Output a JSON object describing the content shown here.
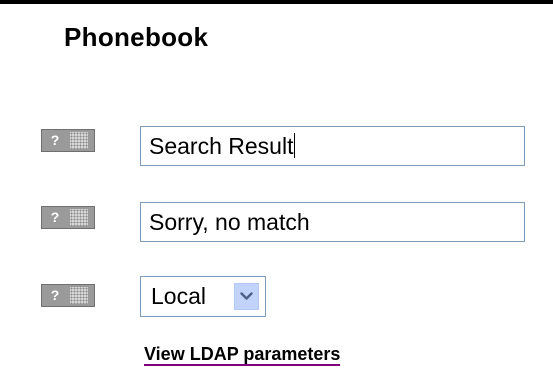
{
  "page": {
    "title": "Phonebook"
  },
  "rows": [
    {
      "help_icon": "question-mark-icon",
      "help_label": "?",
      "value": "Search Result"
    },
    {
      "help_icon": "question-mark-icon",
      "help_label": "?",
      "value": "Sorry, no match"
    },
    {
      "help_icon": "question-mark-icon",
      "help_label": "?",
      "select_value": "Local"
    }
  ],
  "link": {
    "label": "View LDAP parameters"
  },
  "colors": {
    "help_button": "#9a9a9a",
    "field_border": "#7f9db9",
    "dropdown_arrow_bg": "#c1d3fb",
    "link_underline": "#800080"
  }
}
